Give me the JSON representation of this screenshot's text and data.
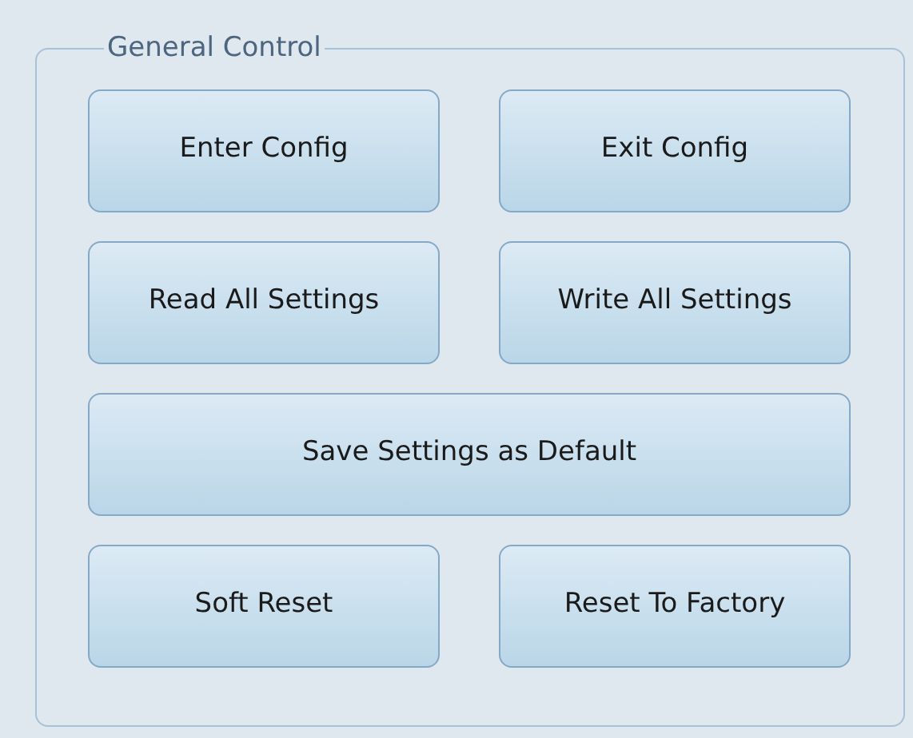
{
  "group": {
    "title": "General Control",
    "rows": [
      [
        "Enter Config",
        "Exit Config"
      ],
      [
        "Read All Settings",
        "Write All Settings"
      ],
      [
        "Save Settings as Default"
      ],
      [
        "Soft Reset",
        "Reset To Factory"
      ]
    ]
  }
}
